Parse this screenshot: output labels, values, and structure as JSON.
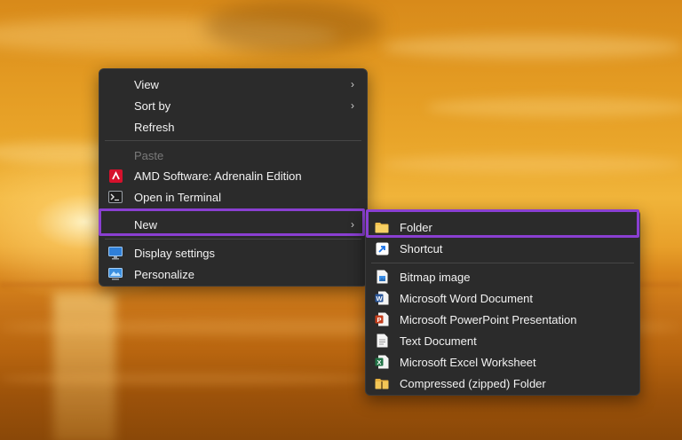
{
  "main_menu": {
    "items": [
      {
        "label": "View",
        "has_submenu": true,
        "icon": "none"
      },
      {
        "label": "Sort by",
        "has_submenu": true,
        "icon": "none"
      },
      {
        "label": "Refresh",
        "has_submenu": false,
        "icon": "none"
      },
      {
        "label": "Paste",
        "has_submenu": false,
        "disabled": true,
        "icon": "none"
      },
      {
        "label": "AMD Software: Adrenalin Edition",
        "has_submenu": false,
        "icon": "amd-icon"
      },
      {
        "label": "Open in Terminal",
        "has_submenu": false,
        "icon": "terminal-icon"
      },
      {
        "label": "New",
        "has_submenu": true,
        "highlighted": true,
        "icon": "none"
      },
      {
        "label": "Display settings",
        "has_submenu": false,
        "icon": "display-settings-icon"
      },
      {
        "label": "Personalize",
        "has_submenu": false,
        "icon": "personalize-icon"
      }
    ]
  },
  "new_submenu": {
    "items": [
      {
        "label": "Folder",
        "highlighted": true,
        "icon": "folder-icon"
      },
      {
        "label": "Shortcut",
        "icon": "shortcut-icon"
      },
      {
        "label": "Bitmap image",
        "icon": "bitmap-icon"
      },
      {
        "label": "Microsoft Word Document",
        "icon": "word-icon"
      },
      {
        "label": "Microsoft PowerPoint Presentation",
        "icon": "powerpoint-icon"
      },
      {
        "label": "Text Document",
        "icon": "text-document-icon"
      },
      {
        "label": "Microsoft Excel Worksheet",
        "icon": "excel-icon"
      },
      {
        "label": "Compressed (zipped) Folder",
        "icon": "zip-folder-icon"
      }
    ]
  },
  "colors": {
    "menu_bg": "#2b2b2b",
    "highlight_border": "#8a3fd1",
    "text": "#f2f2f2",
    "disabled_text": "#7a7a7a"
  }
}
